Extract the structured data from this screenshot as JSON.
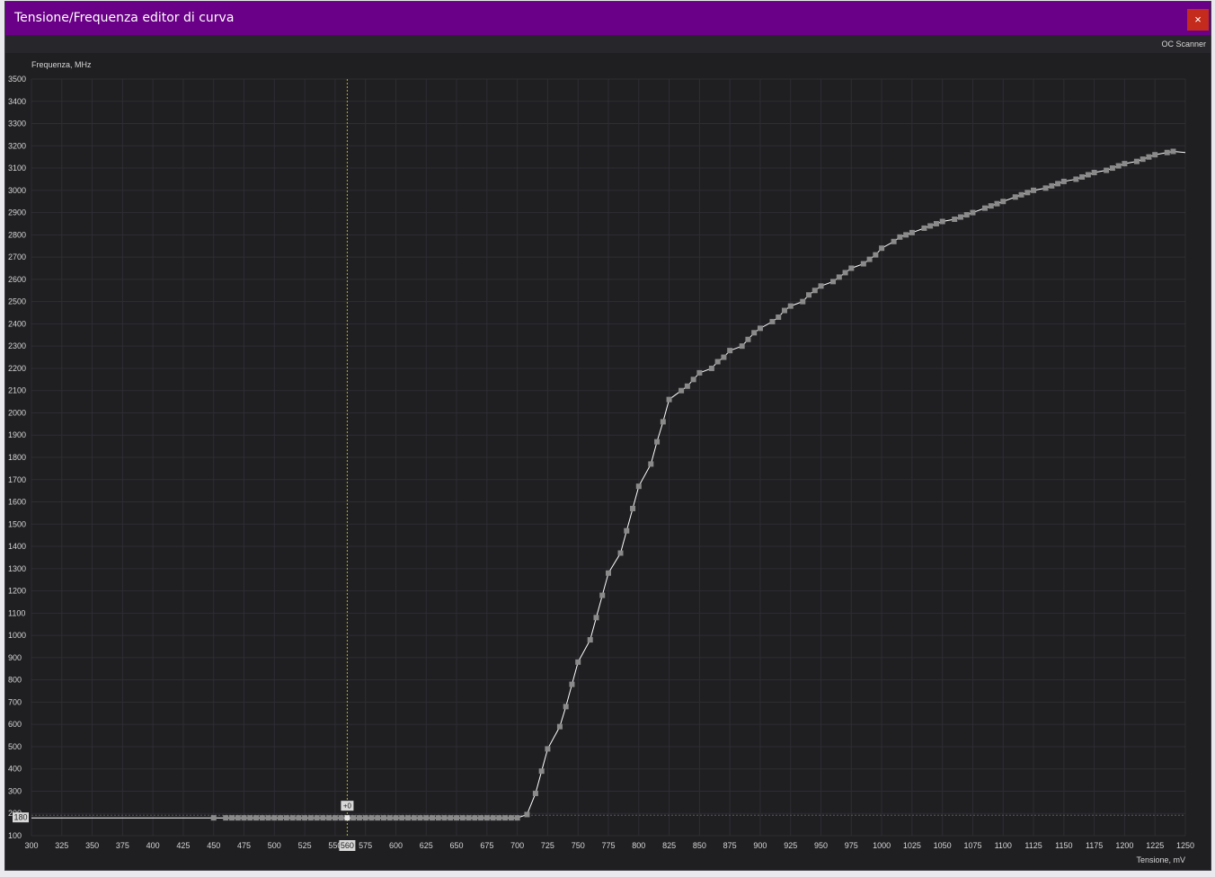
{
  "window": {
    "title": "Tensione/Frequenza editor di curva",
    "close_label": "×",
    "toolbar_button": "OC Scanner"
  },
  "colors": {
    "titlebar": "#6a0087",
    "close_button": "#c42b1c",
    "background": "#1f1f22",
    "grid": "#2e2e33",
    "curve": "#ffffff",
    "points": "#8a8a8a",
    "cursor_line": "#b4b41e"
  },
  "chart_data": {
    "type": "line",
    "xlabel": "Tensione, mV",
    "ylabel": "Frequenza, MHz",
    "xlim": [
      300,
      1250
    ],
    "ylim": [
      100,
      3500
    ],
    "x_ticks": [
      300,
      325,
      350,
      375,
      400,
      425,
      450,
      475,
      500,
      525,
      550,
      575,
      600,
      625,
      650,
      675,
      700,
      725,
      750,
      775,
      800,
      825,
      850,
      875,
      900,
      925,
      950,
      975,
      1000,
      1025,
      1050,
      1075,
      1100,
      1125,
      1150,
      1175,
      1200,
      1225,
      1250
    ],
    "y_ticks": [
      100,
      200,
      300,
      400,
      500,
      600,
      700,
      800,
      900,
      1000,
      1100,
      1200,
      1300,
      1400,
      1500,
      1600,
      1700,
      1800,
      1900,
      2000,
      2100,
      2200,
      2300,
      2400,
      2500,
      2600,
      2700,
      2800,
      2900,
      3000,
      3100,
      3200,
      3300,
      3400,
      3500
    ],
    "grid": true,
    "cursor": {
      "voltage": 560,
      "frequency": 180,
      "voltage_label": "560",
      "frequency_label": "180",
      "offset_label": "+0"
    },
    "series": [
      {
        "points": [
          [
            300,
            180
          ],
          [
            450,
            180
          ],
          [
            460,
            180
          ],
          [
            465,
            180
          ],
          [
            470,
            180
          ],
          [
            475,
            180
          ],
          [
            480,
            180
          ],
          [
            485,
            180
          ],
          [
            490,
            180
          ],
          [
            495,
            180
          ],
          [
            500,
            180
          ],
          [
            505,
            180
          ],
          [
            510,
            180
          ],
          [
            515,
            180
          ],
          [
            520,
            180
          ],
          [
            525,
            180
          ],
          [
            530,
            180
          ],
          [
            535,
            180
          ],
          [
            540,
            180
          ],
          [
            545,
            180
          ],
          [
            550,
            180
          ],
          [
            555,
            180
          ],
          [
            560,
            180
          ],
          [
            565,
            180
          ],
          [
            570,
            180
          ],
          [
            575,
            180
          ],
          [
            580,
            180
          ],
          [
            585,
            180
          ],
          [
            590,
            180
          ],
          [
            595,
            180
          ],
          [
            600,
            180
          ],
          [
            605,
            180
          ],
          [
            610,
            180
          ],
          [
            615,
            180
          ],
          [
            620,
            180
          ],
          [
            625,
            180
          ],
          [
            630,
            180
          ],
          [
            635,
            180
          ],
          [
            640,
            180
          ],
          [
            645,
            180
          ],
          [
            650,
            180
          ],
          [
            655,
            180
          ],
          [
            660,
            180
          ],
          [
            665,
            180
          ],
          [
            670,
            180
          ],
          [
            675,
            180
          ],
          [
            680,
            180
          ],
          [
            685,
            180
          ],
          [
            690,
            180
          ],
          [
            695,
            180
          ],
          [
            700,
            180
          ],
          [
            708,
            195
          ],
          [
            715,
            290
          ],
          [
            720,
            390
          ],
          [
            725,
            490
          ],
          [
            735,
            590
          ],
          [
            740,
            680
          ],
          [
            745,
            780
          ],
          [
            750,
            880
          ],
          [
            760,
            980
          ],
          [
            765,
            1080
          ],
          [
            770,
            1180
          ],
          [
            775,
            1280
          ],
          [
            785,
            1370
          ],
          [
            790,
            1470
          ],
          [
            795,
            1570
          ],
          [
            800,
            1670
          ],
          [
            810,
            1770
          ],
          [
            815,
            1870
          ],
          [
            820,
            1960
          ],
          [
            825,
            2060
          ],
          [
            835,
            2100
          ],
          [
            840,
            2120
          ],
          [
            845,
            2150
          ],
          [
            850,
            2180
          ],
          [
            860,
            2200
          ],
          [
            865,
            2230
          ],
          [
            870,
            2250
          ],
          [
            875,
            2280
          ],
          [
            885,
            2300
          ],
          [
            890,
            2330
          ],
          [
            895,
            2360
          ],
          [
            900,
            2380
          ],
          [
            910,
            2410
          ],
          [
            915,
            2430
          ],
          [
            920,
            2460
          ],
          [
            925,
            2480
          ],
          [
            935,
            2500
          ],
          [
            940,
            2530
          ],
          [
            945,
            2550
          ],
          [
            950,
            2570
          ],
          [
            960,
            2590
          ],
          [
            965,
            2610
          ],
          [
            970,
            2630
          ],
          [
            975,
            2650
          ],
          [
            985,
            2670
          ],
          [
            990,
            2690
          ],
          [
            995,
            2710
          ],
          [
            1000,
            2740
          ],
          [
            1010,
            2770
          ],
          [
            1015,
            2790
          ],
          [
            1020,
            2800
          ],
          [
            1025,
            2810
          ],
          [
            1035,
            2830
          ],
          [
            1040,
            2840
          ],
          [
            1045,
            2850
          ],
          [
            1050,
            2860
          ],
          [
            1060,
            2870
          ],
          [
            1065,
            2880
          ],
          [
            1070,
            2890
          ],
          [
            1075,
            2900
          ],
          [
            1085,
            2920
          ],
          [
            1090,
            2930
          ],
          [
            1095,
            2940
          ],
          [
            1100,
            2950
          ],
          [
            1110,
            2970
          ],
          [
            1115,
            2980
          ],
          [
            1120,
            2990
          ],
          [
            1125,
            3000
          ],
          [
            1135,
            3010
          ],
          [
            1140,
            3020
          ],
          [
            1145,
            3030
          ],
          [
            1150,
            3040
          ],
          [
            1160,
            3050
          ],
          [
            1165,
            3060
          ],
          [
            1170,
            3070
          ],
          [
            1175,
            3080
          ],
          [
            1185,
            3090
          ],
          [
            1190,
            3100
          ],
          [
            1195,
            3110
          ],
          [
            1200,
            3120
          ],
          [
            1210,
            3130
          ],
          [
            1215,
            3140
          ],
          [
            1220,
            3150
          ],
          [
            1225,
            3160
          ],
          [
            1235,
            3170
          ],
          [
            1240,
            3175
          ],
          [
            1250,
            3170
          ]
        ]
      }
    ]
  }
}
